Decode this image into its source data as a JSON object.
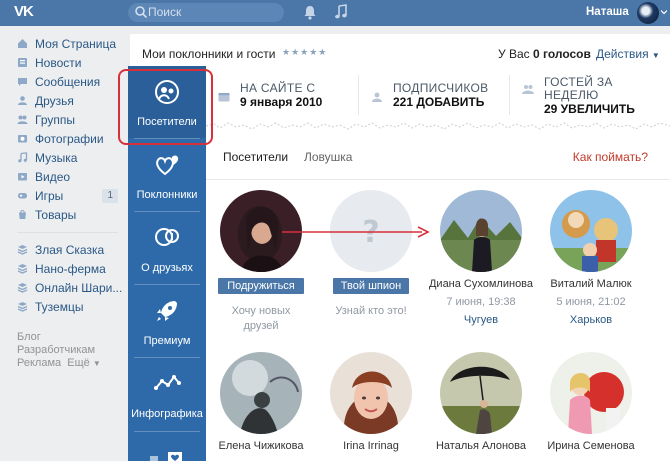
{
  "topbar": {
    "logo": "VK",
    "search_placeholder": "Поиск",
    "user_name": "Наташа",
    "icons": [
      "search-icon",
      "bell-icon",
      "music-icon",
      "chevron-down-icon"
    ]
  },
  "leftnav": {
    "items": [
      {
        "label": "Моя Страница",
        "icon": "home-icon"
      },
      {
        "label": "Новости",
        "icon": "news-icon"
      },
      {
        "label": "Сообщения",
        "icon": "messages-icon"
      },
      {
        "label": "Друзья",
        "icon": "friends-icon"
      },
      {
        "label": "Группы",
        "icon": "groups-icon"
      },
      {
        "label": "Фотографии",
        "icon": "photos-icon"
      },
      {
        "label": "Музыка",
        "icon": "music-icon"
      },
      {
        "label": "Видео",
        "icon": "video-icon"
      },
      {
        "label": "Игры",
        "icon": "games-icon",
        "count": "1"
      },
      {
        "label": "Товары",
        "icon": "goods-icon"
      }
    ],
    "apps": [
      {
        "label": "Злая Сказка",
        "icon": "app-icon"
      },
      {
        "label": "Нано-ферма",
        "icon": "app-icon"
      },
      {
        "label": "Онлайн Шари...",
        "icon": "app-icon"
      },
      {
        "label": "Туземцы",
        "icon": "app-icon"
      }
    ],
    "footer": [
      "Блог",
      "Разработчикам",
      "Реклама",
      "Ещё"
    ]
  },
  "appside": {
    "tiles": [
      {
        "label": "Посетители",
        "icon": "visitors-icon"
      },
      {
        "label": "Поклонники",
        "icon": "fans-icon"
      },
      {
        "label": "О друзьях",
        "icon": "about-friends-icon"
      },
      {
        "label": "Премиум",
        "icon": "rocket-icon"
      },
      {
        "label": "Инфографика",
        "icon": "infographics-icon"
      }
    ]
  },
  "main": {
    "title": "Мои поклонники и гости",
    "stars": "★★★★★",
    "votes_prefix": "У Вас",
    "votes_count": "0 голосов",
    "actions": "Действия",
    "stats": [
      {
        "line1": "НА САЙТЕ С",
        "line2": "9 января 2010",
        "icon": "calendar-icon"
      },
      {
        "line1": "ПОДПИСЧИКОВ",
        "line2": "221 ДОБАВИТЬ",
        "icon": "subscribers-icon"
      },
      {
        "line1": "ГОСТЕЙ ЗА",
        "line2": "НЕДЕЛЮ",
        "line3": "29 УВЕЛИЧИТЬ",
        "icon": "guests-icon"
      }
    ],
    "tabs": [
      "Посетители",
      "Ловушка"
    ],
    "howto": "Как поймать?"
  },
  "visitors": [
    {
      "button": "Подружиться",
      "hint": "Хочу новых друзей"
    },
    {
      "button": "Твой шпион",
      "hint": "Узнай кто это!"
    },
    {
      "name": "Диана Сухомлинова",
      "date": "7 июня, 19:38",
      "city": "Чугуев"
    },
    {
      "name": "Виталий Малюк",
      "date": "5 июня, 21:02",
      "city": "Харьков"
    },
    {
      "name": "Елена Чижикова"
    },
    {
      "name": "Irina Irrinag"
    },
    {
      "name": "Наталья Алонова"
    },
    {
      "name": "Ирина Семенова"
    }
  ],
  "colors": {
    "topbar": "#4a76a8",
    "appside": "#2e6aa9",
    "link": "#2a5885",
    "highlight": "#d73038"
  }
}
